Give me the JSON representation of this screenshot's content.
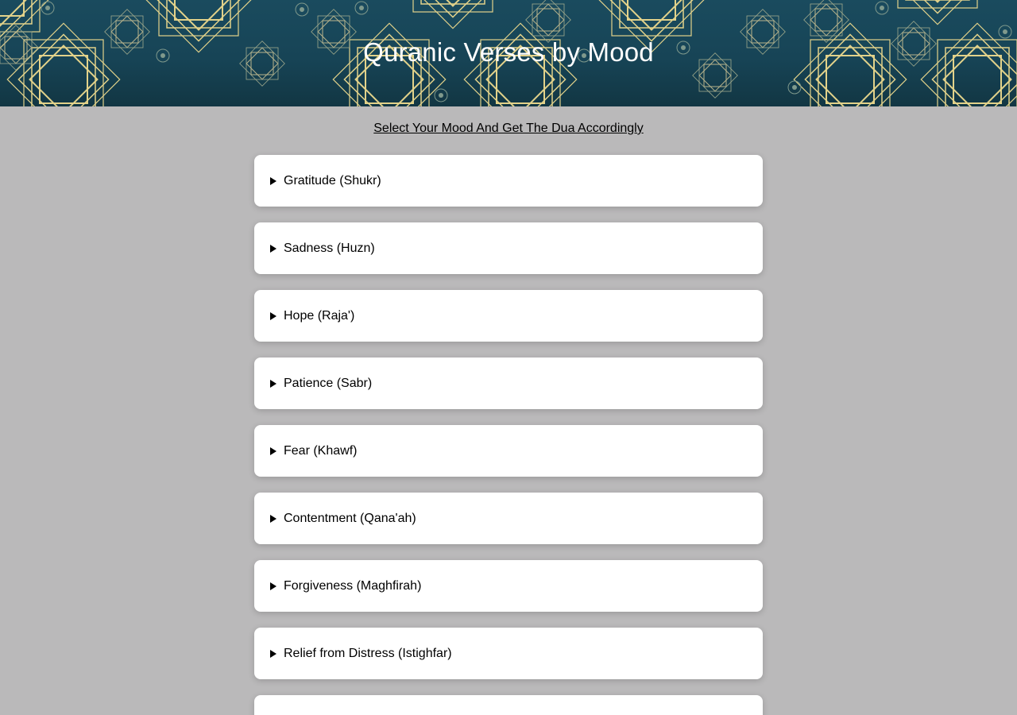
{
  "header": {
    "title": "Quranic Verses by Mood"
  },
  "subtitle": "Select Your Mood And Get The Dua Accordingly",
  "moods": [
    {
      "label": "Gratitude (Shukr)"
    },
    {
      "label": "Sadness (Huzn)"
    },
    {
      "label": "Hope (Raja')"
    },
    {
      "label": "Patience (Sabr)"
    },
    {
      "label": "Fear (Khawf)"
    },
    {
      "label": "Contentment (Qana'ah)"
    },
    {
      "label": "Forgiveness (Maghfirah)"
    },
    {
      "label": "Relief from Distress (Istighfar)"
    },
    {
      "label": ""
    }
  ],
  "colors": {
    "banner": "#174456",
    "pattern_gold": "#e2d28a",
    "page_background": "#bab9ba",
    "card": "#ffffff"
  },
  "icons": {
    "expand": "disclosure-triangle-icon",
    "banner_pattern": "islamic-star-pattern"
  }
}
